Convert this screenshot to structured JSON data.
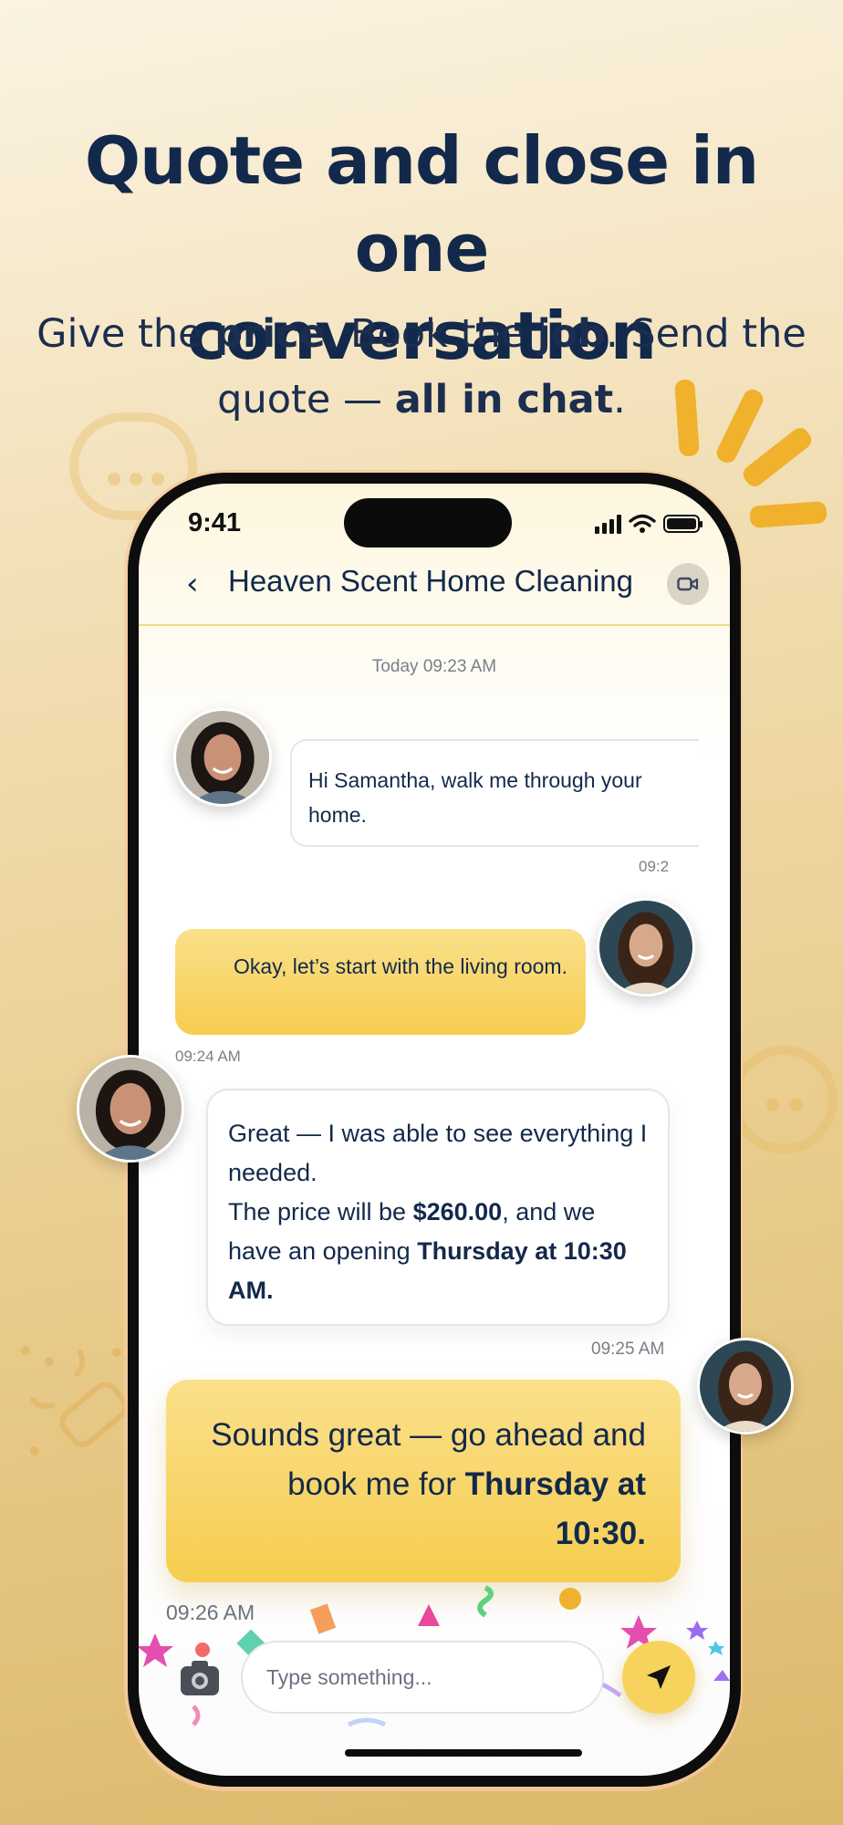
{
  "marketing": {
    "headline_line1": "Quote and close in one",
    "headline_line2": "conversation",
    "sub_1": "Give the ",
    "sub_price": "price",
    "sub_2": ". Book the ",
    "sub_job": "job",
    "sub_3": ". Send the",
    "sub_4": "quote — ",
    "sub_all": "all in chat",
    "sub_5": "."
  },
  "status_bar": {
    "time": "9:41"
  },
  "chat": {
    "title": "Heaven Scent Home Cleaning",
    "day_stamp": "Today 09:23 AM",
    "messages": [
      {
        "from": "business",
        "text": "Hi Samantha, walk me through your home.",
        "time": "09:2"
      },
      {
        "from": "customer",
        "text": "Okay, let’s start with the living room.",
        "time": "09:24 AM"
      },
      {
        "from": "business",
        "line1": "Great — I was able to see everything I needed.",
        "line2_a": "The price will be ",
        "line2_price": "$260.00",
        "line2_b": ", and we have an opening ",
        "line2_slot": "Thursday at 10:30 AM.",
        "time": "09:25 AM"
      },
      {
        "from": "customer",
        "text_a": "Sounds great — go ahead and book me for ",
        "text_slot": "Thursday at 10:30.",
        "time": "09:26 AM"
      }
    ]
  },
  "composer": {
    "placeholder": "Type something..."
  },
  "icons": [
    "back-icon",
    "video-call-icon",
    "camera-icon",
    "send-icon",
    "signal-icon",
    "wifi-icon",
    "battery-icon"
  ],
  "colors": {
    "navy": "#13294b",
    "accent_yellow": "#f6cd4f",
    "ray_orange": "#f0b12d"
  }
}
